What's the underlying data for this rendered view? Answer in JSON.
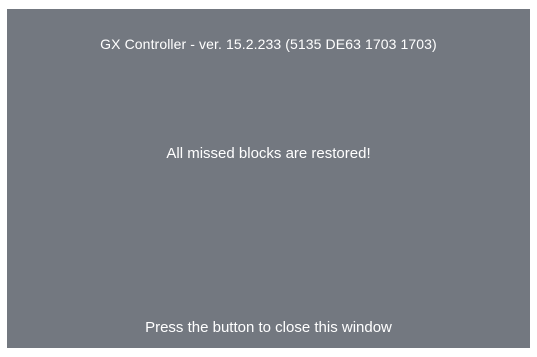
{
  "window": {
    "title": "GX Controller - ver. 15.2.233 (5135 DE63 1703 1703)",
    "message": "All missed blocks are restored!",
    "close_hint": "Press the button to close this window"
  },
  "colors": {
    "panel_background": "#737880",
    "text": "#ffffff",
    "page_background": "#ffffff"
  }
}
